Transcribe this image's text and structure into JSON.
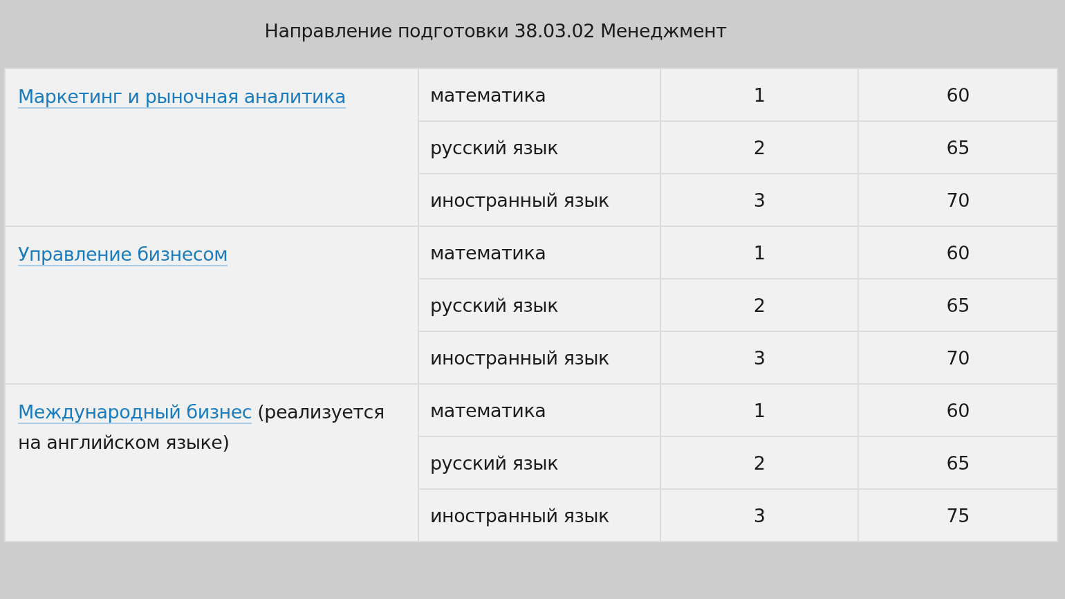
{
  "title": "Направление подготовки 38.03.02 Менеджмент",
  "programs": [
    {
      "link": "Маркетинг и рыночная аналитика",
      "subjects": [
        {
          "name": "математика",
          "priority": "1",
          "score": "60"
        },
        {
          "name": "русский язык",
          "priority": "2",
          "score": "65"
        },
        {
          "name": "иностранный язык",
          "priority": "3",
          "score": "70"
        }
      ]
    },
    {
      "link": "Управление бизнесом",
      "subjects": [
        {
          "name": "математика",
          "priority": "1",
          "score": "60"
        },
        {
          "name": "русский язык",
          "priority": "2",
          "score": "65"
        },
        {
          "name": "иностранный язык",
          "priority": "3",
          "score": "70"
        }
      ]
    },
    {
      "link": "Международный бизнес",
      "note": "(реализуется на английском языке)",
      "subjects": [
        {
          "name": "математика",
          "priority": "1",
          "score": "60"
        },
        {
          "name": "русский язык",
          "priority": "2",
          "score": "65"
        },
        {
          "name": "иностранный язык",
          "priority": "3",
          "score": "75"
        }
      ]
    }
  ]
}
